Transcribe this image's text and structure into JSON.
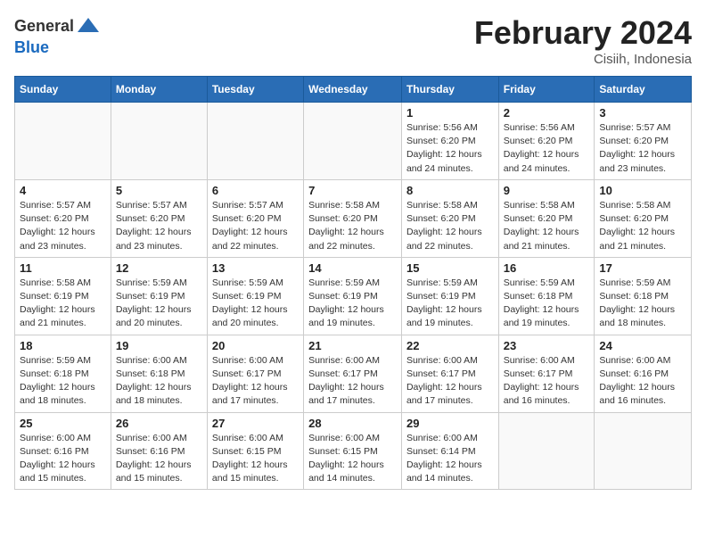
{
  "logo": {
    "general": "General",
    "blue": "Blue"
  },
  "title": "February 2024",
  "subtitle": "Cisiih, Indonesia",
  "days_of_week": [
    "Sunday",
    "Monday",
    "Tuesday",
    "Wednesday",
    "Thursday",
    "Friday",
    "Saturday"
  ],
  "weeks": [
    [
      {
        "day": "",
        "info": ""
      },
      {
        "day": "",
        "info": ""
      },
      {
        "day": "",
        "info": ""
      },
      {
        "day": "",
        "info": ""
      },
      {
        "day": "1",
        "info": "Sunrise: 5:56 AM\nSunset: 6:20 PM\nDaylight: 12 hours\nand 24 minutes."
      },
      {
        "day": "2",
        "info": "Sunrise: 5:56 AM\nSunset: 6:20 PM\nDaylight: 12 hours\nand 24 minutes."
      },
      {
        "day": "3",
        "info": "Sunrise: 5:57 AM\nSunset: 6:20 PM\nDaylight: 12 hours\nand 23 minutes."
      }
    ],
    [
      {
        "day": "4",
        "info": "Sunrise: 5:57 AM\nSunset: 6:20 PM\nDaylight: 12 hours\nand 23 minutes."
      },
      {
        "day": "5",
        "info": "Sunrise: 5:57 AM\nSunset: 6:20 PM\nDaylight: 12 hours\nand 23 minutes."
      },
      {
        "day": "6",
        "info": "Sunrise: 5:57 AM\nSunset: 6:20 PM\nDaylight: 12 hours\nand 22 minutes."
      },
      {
        "day": "7",
        "info": "Sunrise: 5:58 AM\nSunset: 6:20 PM\nDaylight: 12 hours\nand 22 minutes."
      },
      {
        "day": "8",
        "info": "Sunrise: 5:58 AM\nSunset: 6:20 PM\nDaylight: 12 hours\nand 22 minutes."
      },
      {
        "day": "9",
        "info": "Sunrise: 5:58 AM\nSunset: 6:20 PM\nDaylight: 12 hours\nand 21 minutes."
      },
      {
        "day": "10",
        "info": "Sunrise: 5:58 AM\nSunset: 6:20 PM\nDaylight: 12 hours\nand 21 minutes."
      }
    ],
    [
      {
        "day": "11",
        "info": "Sunrise: 5:58 AM\nSunset: 6:19 PM\nDaylight: 12 hours\nand 21 minutes."
      },
      {
        "day": "12",
        "info": "Sunrise: 5:59 AM\nSunset: 6:19 PM\nDaylight: 12 hours\nand 20 minutes."
      },
      {
        "day": "13",
        "info": "Sunrise: 5:59 AM\nSunset: 6:19 PM\nDaylight: 12 hours\nand 20 minutes."
      },
      {
        "day": "14",
        "info": "Sunrise: 5:59 AM\nSunset: 6:19 PM\nDaylight: 12 hours\nand 19 minutes."
      },
      {
        "day": "15",
        "info": "Sunrise: 5:59 AM\nSunset: 6:19 PM\nDaylight: 12 hours\nand 19 minutes."
      },
      {
        "day": "16",
        "info": "Sunrise: 5:59 AM\nSunset: 6:18 PM\nDaylight: 12 hours\nand 19 minutes."
      },
      {
        "day": "17",
        "info": "Sunrise: 5:59 AM\nSunset: 6:18 PM\nDaylight: 12 hours\nand 18 minutes."
      }
    ],
    [
      {
        "day": "18",
        "info": "Sunrise: 5:59 AM\nSunset: 6:18 PM\nDaylight: 12 hours\nand 18 minutes."
      },
      {
        "day": "19",
        "info": "Sunrise: 6:00 AM\nSunset: 6:18 PM\nDaylight: 12 hours\nand 18 minutes."
      },
      {
        "day": "20",
        "info": "Sunrise: 6:00 AM\nSunset: 6:17 PM\nDaylight: 12 hours\nand 17 minutes."
      },
      {
        "day": "21",
        "info": "Sunrise: 6:00 AM\nSunset: 6:17 PM\nDaylight: 12 hours\nand 17 minutes."
      },
      {
        "day": "22",
        "info": "Sunrise: 6:00 AM\nSunset: 6:17 PM\nDaylight: 12 hours\nand 17 minutes."
      },
      {
        "day": "23",
        "info": "Sunrise: 6:00 AM\nSunset: 6:17 PM\nDaylight: 12 hours\nand 16 minutes."
      },
      {
        "day": "24",
        "info": "Sunrise: 6:00 AM\nSunset: 6:16 PM\nDaylight: 12 hours\nand 16 minutes."
      }
    ],
    [
      {
        "day": "25",
        "info": "Sunrise: 6:00 AM\nSunset: 6:16 PM\nDaylight: 12 hours\nand 15 minutes."
      },
      {
        "day": "26",
        "info": "Sunrise: 6:00 AM\nSunset: 6:16 PM\nDaylight: 12 hours\nand 15 minutes."
      },
      {
        "day": "27",
        "info": "Sunrise: 6:00 AM\nSunset: 6:15 PM\nDaylight: 12 hours\nand 15 minutes."
      },
      {
        "day": "28",
        "info": "Sunrise: 6:00 AM\nSunset: 6:15 PM\nDaylight: 12 hours\nand 14 minutes."
      },
      {
        "day": "29",
        "info": "Sunrise: 6:00 AM\nSunset: 6:14 PM\nDaylight: 12 hours\nand 14 minutes."
      },
      {
        "day": "",
        "info": ""
      },
      {
        "day": "",
        "info": ""
      }
    ]
  ]
}
